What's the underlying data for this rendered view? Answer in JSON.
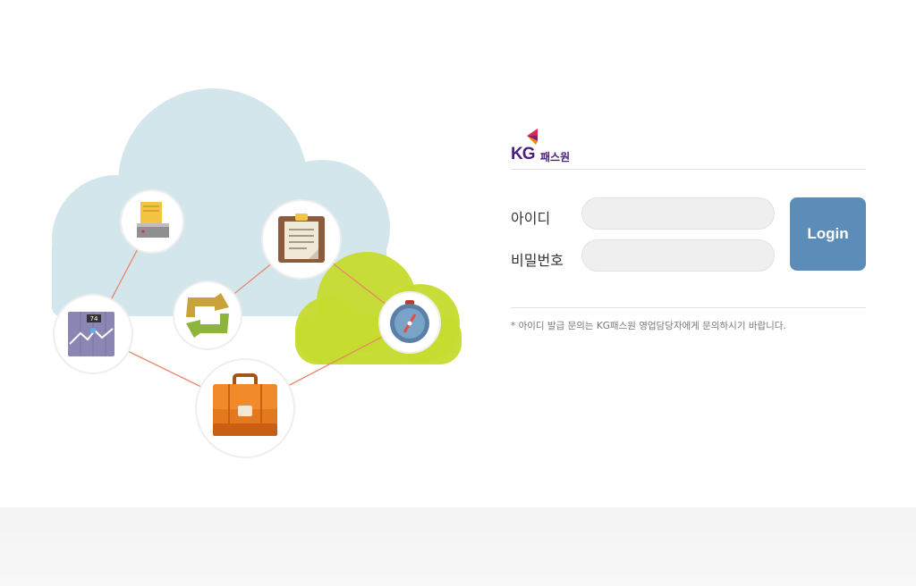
{
  "brand": {
    "logo_kg": "KG",
    "logo_name": "패스원",
    "colors": {
      "primary": "#4a1f7a",
      "accent_red": "#e0254c",
      "accent_orange": "#f08a1c"
    }
  },
  "form": {
    "id_label": "아이디",
    "id_value": "",
    "pw_label": "비밀번호",
    "pw_value": "",
    "login_label": "Login",
    "login_color": "#5b8db8"
  },
  "notice": "* 아이디 발급 문의는 KG패스원 영업담당자에게 문의하시기 바랍니다.",
  "illustration": {
    "cloud_colors": {
      "blue": "#d2e6ec",
      "green": "#c6db2e"
    },
    "icons": [
      "printer-icon",
      "clipboard-icon",
      "sync-arrows-icon",
      "chart-tablet-icon",
      "compass-icon",
      "briefcase-icon"
    ],
    "tablet_badge": "74"
  }
}
